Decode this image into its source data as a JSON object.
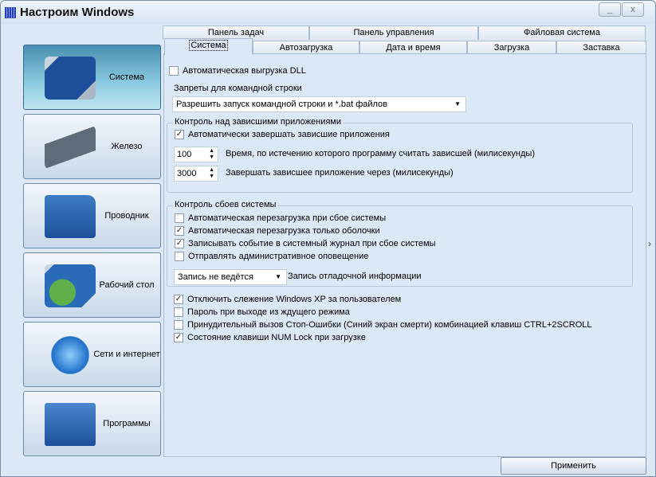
{
  "window": {
    "title": "Настроим Windows",
    "minimize": "_",
    "close": "x"
  },
  "sidebar": [
    {
      "label": "Система",
      "icon": "monitor-icon",
      "selected": true
    },
    {
      "label": "Железо",
      "icon": "hard-drive-icon"
    },
    {
      "label": "Проводник",
      "icon": "folder-icon"
    },
    {
      "label": "Рабочий стол",
      "icon": "desktop-icon"
    },
    {
      "label": "Сети и интернет",
      "icon": "globe-icon"
    },
    {
      "label": "Программы",
      "icon": "programs-icon"
    }
  ],
  "tabs_top": [
    "Панель задач",
    "Панель управления",
    "Файловая система"
  ],
  "tabs_bottom": [
    "Система",
    "Автозагрузка",
    "Дата и время",
    "Загрузка",
    "Заставка"
  ],
  "main": {
    "dll_unload": {
      "label": "Автоматическая выгрузка DLL",
      "checked": false
    },
    "cmd_label": "Запреты для командной строки",
    "cmd_value": "Разрешить запуск командной строки и  *.bat файлов",
    "hung": {
      "legend": "Контроль над зависшими приложениями",
      "auto_end": {
        "label": "Автоматически завершать зависшие приложения",
        "checked": true
      },
      "timeout_value": "100",
      "timeout_label": "Время, по истечению которого программу считать зависшей (милисекунды)",
      "kill_value": "3000",
      "kill_label": "Завершать зависшее приложение через (милисекунды)"
    },
    "crash": {
      "legend": "Контроль сбоев системы",
      "items": [
        {
          "label": "Автоматическая перезагрузка при сбое системы",
          "checked": false
        },
        {
          "label": "Автоматическая перезагрузка только оболочки",
          "checked": true
        },
        {
          "label": "Записывать событие в системный журнал при сбое системы",
          "checked": true
        },
        {
          "label": "Отправлять административное оповещение",
          "checked": false
        }
      ],
      "debug_value": "Запись не ведётся",
      "debug_label": "Запись отладочной информации"
    },
    "misc": [
      {
        "label": "Отключить слежение Windows XP за пользователем",
        "checked": true
      },
      {
        "label": "Пароль при выходе из ждущего режима",
        "checked": false
      },
      {
        "label": "Принудительный вызов Стоп-Ошибки (Синий экран смерти) комбинацией клавиш CTRL+2SCROLL",
        "checked": false
      },
      {
        "label": "Состояние клавиши NUM Lock при загрузке",
        "checked": true
      }
    ]
  },
  "apply_label": "Применить",
  "scroll_arrow": "›"
}
